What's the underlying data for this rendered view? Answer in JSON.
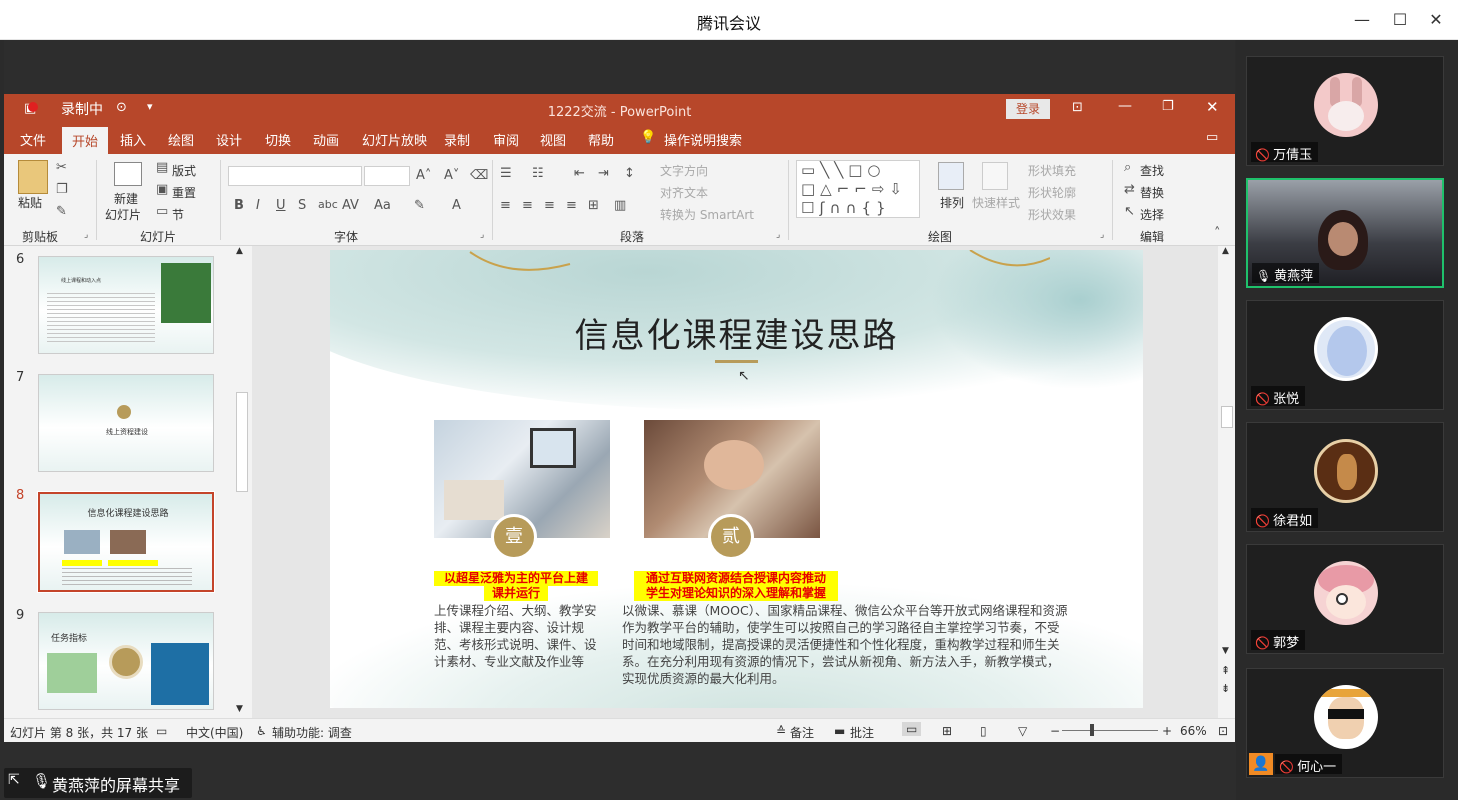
{
  "window": {
    "title": "腾讯会议",
    "minimize": "—",
    "maximize": "☐",
    "close": "✕"
  },
  "ppt": {
    "recording": "录制中",
    "doc_title": "1222交流 - PowerPoint",
    "login": "登录",
    "tabs": [
      "文件",
      "开始",
      "插入",
      "绘图",
      "设计",
      "切换",
      "动画",
      "幻灯片放映",
      "录制",
      "审阅",
      "视图",
      "帮助"
    ],
    "tell_me": "操作说明搜索",
    "ribbon": {
      "paste": "粘贴",
      "clipboard": "剪贴板",
      "new_slide_1": "新建",
      "new_slide_2": "幻灯片",
      "layout": "版式",
      "reset": "重置",
      "section": "节",
      "slides_group": "幻灯片",
      "font_group": "字体",
      "text_direction": "文字方向",
      "align_text": "对齐文本",
      "smartart": "转换为 SmartArt",
      "paragraph_group": "段落",
      "arrange": "排列",
      "quick_styles": "快速样式",
      "shape_fill": "形状填充",
      "shape_outline": "形状轮廓",
      "shape_effects": "形状效果",
      "drawing_group": "绘图",
      "find": "查找",
      "replace": "替换",
      "select": "选择",
      "editing_group": "编辑"
    },
    "thumbs": [
      {
        "num": "6",
        "title": "线上课程和动入点"
      },
      {
        "num": "7",
        "title": "线上资程建设"
      },
      {
        "num": "8",
        "title": "信息化课程建设思路"
      },
      {
        "num": "9",
        "title": "任务指标"
      }
    ],
    "slide": {
      "title": "信息化课程建设思路",
      "badge1": "壹",
      "badge2": "贰",
      "highlight1_l1": "以超星泛雅为主的平台上建",
      "highlight1_l2": "课并运行",
      "highlight2_l1": "通过互联网资源结合授课内容推动",
      "highlight2_l2": "学生对理论知识的深入理解和掌握",
      "body1": "上传课程介绍、大纲、教学安排、课程主要内容、设计规范、考核形式说明、课件、设计素材、专业文献及作业等",
      "body2": "以微课、慕课（MOOC）、国家精品课程、微信公众平台等开放式网络课程和资源作为教学平台的辅助，使学生可以按照自己的学习路径自主掌控学习节奏，不受时间和地域限制，提高授课的灵活便捷性和个性化程度，重构教学过程和师生关系。在充分利用现有资源的情况下，尝试从新视角、新方法入手，新教学模式，实现优质资源的最大化利用。"
    },
    "status": {
      "slide_info": "幻灯片 第 8 张，共 17 张",
      "language": "中文(中国)",
      "accessibility": "辅助功能: 调查",
      "notes": "备注",
      "comments": "批注",
      "zoom": "66%",
      "minus": "−",
      "plus": "+"
    }
  },
  "participants": [
    {
      "name": "万倩玉",
      "muted": true
    },
    {
      "name": "黄燕萍",
      "muted": false
    },
    {
      "name": "张悦",
      "muted": true
    },
    {
      "name": "徐君如",
      "muted": true
    },
    {
      "name": "郭梦",
      "muted": true
    },
    {
      "name": "何心一",
      "muted": true
    }
  ],
  "share_label": "黄燕萍的屏幕共享",
  "colors": {
    "ppt_accent": "#b7472a",
    "highlight_bg": "#ffff00",
    "highlight_text": "#e60000",
    "gold": "#b79b5a",
    "active_speaker": "#1fc16b"
  }
}
